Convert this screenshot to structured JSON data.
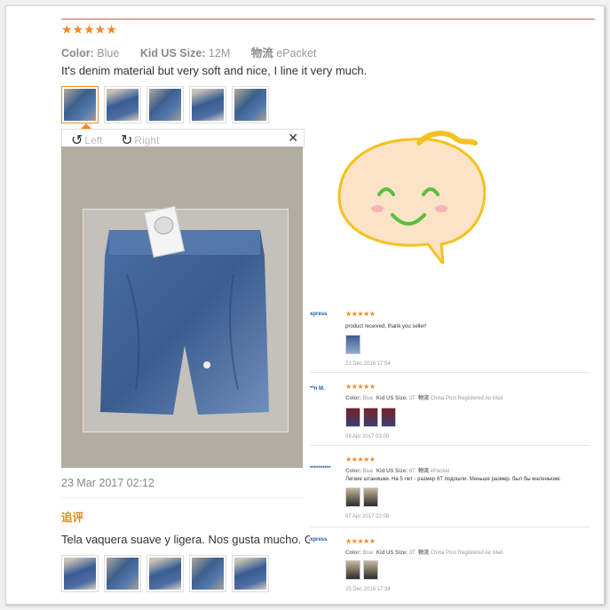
{
  "main_review": {
    "stars": "★★★★★",
    "color_label": "Color:",
    "color_value": "Blue",
    "size_label": "Kid US Size:",
    "size_value": "12M",
    "shipping_label": "物流",
    "shipping_value": "ePacket",
    "text": "It's denim material but very soft and nice, I line it very much.",
    "date": "23 Mar 2017 02:12",
    "followup_label": "追评",
    "followup_text": "Tela vaquera suave y ligera. Nos gusta mucho. Gr"
  },
  "viewer": {
    "rotate_left_icon": "↺",
    "rotate_left_label": "Left",
    "rotate_right_icon": "↻",
    "rotate_right_label": "Right",
    "close_icon": "✕"
  },
  "thumbnail_count": 5,
  "side_reviews": [
    {
      "name": "xpress",
      "stars": "★★★★★",
      "text": "product received, thank you seller!",
      "date": "22 Dec 2016 17:54"
    },
    {
      "name": "**n M.",
      "stars": "★★★★★",
      "color_label": "Color:",
      "color_value": "Blue",
      "size_label": "Kid US Size:",
      "size_value": "3T",
      "ship_label": "物流",
      "ship_value": "China Post Registered Air Mail",
      "date": "08 Apr 2017 03:00"
    },
    {
      "name": "**********",
      "stars": "★★★★★",
      "color_label": "Color:",
      "color_value": "Blue",
      "size_label": "Kid US Size:",
      "size_value": "6T",
      "ship_label": "物流",
      "ship_value": "ePacket",
      "text": "Легкие штанишки. На 5 лет - размер 6T подошли. Меньше размер. был бы маленьким.",
      "date": "07 Apr 2017 22:08"
    },
    {
      "name": "xpress",
      "stars": "★★★★★",
      "color_label": "Color:",
      "color_value": "Blue",
      "size_label": "Kid US Size:",
      "size_value": "3T",
      "ship_label": "物流",
      "ship_value": "China Post Registered Air Mail",
      "date": "25 Dec 2016 17:34"
    }
  ],
  "colors": {
    "accent": "#f08a24",
    "link": "#1a5aa0",
    "topline": "#c46a3a"
  }
}
